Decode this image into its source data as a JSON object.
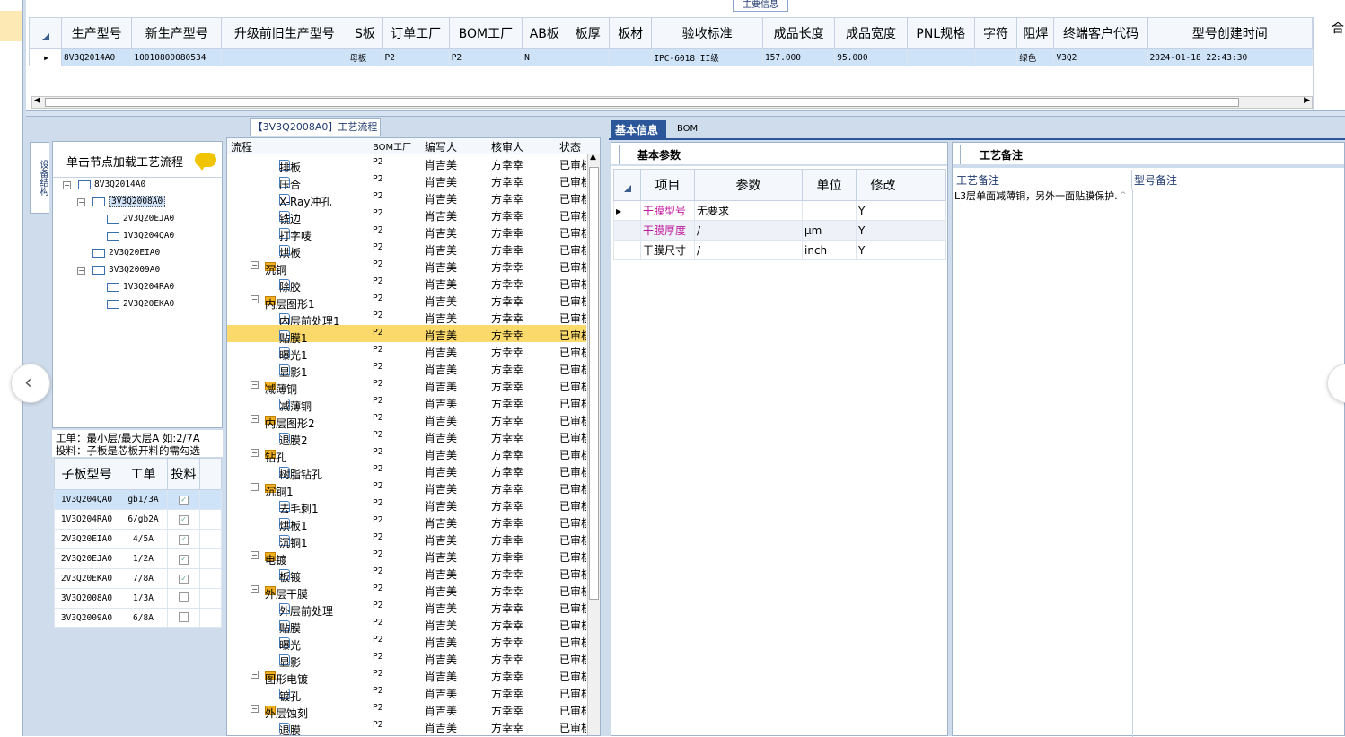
{
  "main_title": "主要信息",
  "top_table": {
    "headers": [
      "生产型号",
      "新生产型号",
      "升级前旧生产型号",
      "S板",
      "订单工厂",
      "BOM工厂",
      "AB板",
      "板厚",
      "板材",
      "验收标准",
      "成品长度",
      "成品宽度",
      "PNL规格",
      "字符",
      "阻焊",
      "终端客户代码",
      "型号创建时间"
    ],
    "extra_header": "合:",
    "row": [
      "8V3Q2014A0",
      "10010800080534",
      "",
      "母板",
      "P2",
      "P2",
      "N",
      "",
      "",
      "IPC-6018 II级",
      "157.000",
      "95.000",
      "",
      "",
      "绿色",
      "V3Q2",
      "2024-01-18 22:43:30"
    ]
  },
  "left": {
    "side_tab": "设备结构",
    "tree_header": "单击节点加载工艺流程",
    "tree": [
      "8V3Q2014A0",
      "3V3Q2008A0",
      "2V3Q20EJA0",
      "1V3Q204QA0",
      "2V3Q20EIA0",
      "3V3Q2009A0",
      "1V3Q204RA0",
      "2V3Q20EKA0"
    ],
    "note1": "工单：最小层/最大层A 如:2/7A",
    "note2": "投料：子板是芯板开料的需勾选",
    "sub_headers": [
      "子板型号",
      "工单",
      "投料"
    ],
    "sub_rows": [
      [
        "1V3Q204QA0",
        "gb1/3A"
      ],
      [
        "1V3Q204RA0",
        "6/gb2A"
      ],
      [
        "2V3Q20EIA0",
        "4/5A"
      ],
      [
        "2V3Q20EJA0",
        "1/2A"
      ],
      [
        "2V3Q20EKA0",
        "7/8A"
      ],
      [
        "3V3Q2008A0",
        "1/3A"
      ],
      [
        "3V3Q2009A0",
        "6/8A"
      ]
    ]
  },
  "flow": {
    "title": "【3V3Q2008A0】工艺流程",
    "headers": [
      "流程",
      "BOM工厂",
      "编写人",
      "核审人",
      "状态"
    ],
    "rows": [
      {
        "name": "排板",
        "f": "P2",
        "w": "肖吉美",
        "r": "方幸幸",
        "s": "已审核",
        "lvl": 2
      },
      {
        "name": "压合",
        "f": "P2",
        "w": "肖吉美",
        "r": "方幸幸",
        "s": "已审核",
        "lvl": 2
      },
      {
        "name": "X-Ray冲孔",
        "f": "P2",
        "w": "肖吉美",
        "r": "方幸幸",
        "s": "已审核",
        "lvl": 2
      },
      {
        "name": "铣边",
        "f": "P2",
        "w": "肖吉美",
        "r": "方幸幸",
        "s": "已审核",
        "lvl": 2
      },
      {
        "name": "打字唛",
        "f": "P2",
        "w": "肖吉美",
        "r": "方幸幸",
        "s": "已审核",
        "lvl": 2
      },
      {
        "name": "烘板",
        "f": "P2",
        "w": "肖吉美",
        "r": "方幸幸",
        "s": "已审核",
        "lvl": 2
      },
      {
        "name": "沉铜",
        "f": "P2",
        "w": "肖吉美",
        "r": "方幸幸",
        "s": "已审核",
        "lvl": 1
      },
      {
        "name": "除胶",
        "f": "P2",
        "w": "肖吉美",
        "r": "方幸幸",
        "s": "已审核",
        "lvl": 2
      },
      {
        "name": "内层图形1",
        "f": "P2",
        "w": "肖吉美",
        "r": "方幸幸",
        "s": "已审核",
        "lvl": 1
      },
      {
        "name": "内层前处理1",
        "f": "P2",
        "w": "肖吉美",
        "r": "方幸幸",
        "s": "已审核",
        "lvl": 2
      },
      {
        "name": "贴膜1",
        "f": "P2",
        "w": "肖吉美",
        "r": "方幸幸",
        "s": "已审核",
        "lvl": 2
      },
      {
        "name": "曝光1",
        "f": "P2",
        "w": "肖吉美",
        "r": "方幸幸",
        "s": "已审核",
        "lvl": 2
      },
      {
        "name": "显影1",
        "f": "P2",
        "w": "肖吉美",
        "r": "方幸幸",
        "s": "已审核",
        "lvl": 2
      },
      {
        "name": "减薄铜",
        "f": "P2",
        "w": "肖吉美",
        "r": "方幸幸",
        "s": "已审核",
        "lvl": 1
      },
      {
        "name": "减薄铜",
        "f": "P2",
        "w": "肖吉美",
        "r": "方幸幸",
        "s": "已审核",
        "lvl": 2
      },
      {
        "name": "内层图形2",
        "f": "P2",
        "w": "肖吉美",
        "r": "方幸幸",
        "s": "已审核",
        "lvl": 1
      },
      {
        "name": "退膜2",
        "f": "P2",
        "w": "肖吉美",
        "r": "方幸幸",
        "s": "已审核",
        "lvl": 2
      },
      {
        "name": "钻孔",
        "f": "P2",
        "w": "肖吉美",
        "r": "方幸幸",
        "s": "已审核",
        "lvl": 1
      },
      {
        "name": "树脂钻孔",
        "f": "P2",
        "w": "肖吉美",
        "r": "方幸幸",
        "s": "已审核",
        "lvl": 2
      },
      {
        "name": "沉铜1",
        "f": "P2",
        "w": "肖吉美",
        "r": "方幸幸",
        "s": "已审核",
        "lvl": 1
      },
      {
        "name": "去毛刺1",
        "f": "P2",
        "w": "肖吉美",
        "r": "方幸幸",
        "s": "已审核",
        "lvl": 2
      },
      {
        "name": "烘板1",
        "f": "P2",
        "w": "肖吉美",
        "r": "方幸幸",
        "s": "已审核",
        "lvl": 2
      },
      {
        "name": "沉铜1",
        "f": "P2",
        "w": "肖吉美",
        "r": "方幸幸",
        "s": "已审核",
        "lvl": 2
      },
      {
        "name": "电镀",
        "f": "P2",
        "w": "肖吉美",
        "r": "方幸幸",
        "s": "已审核",
        "lvl": 1
      },
      {
        "name": "板镀",
        "f": "P2",
        "w": "肖吉美",
        "r": "方幸幸",
        "s": "已审核",
        "lvl": 2
      },
      {
        "name": "外层干膜",
        "f": "P2",
        "w": "肖吉美",
        "r": "方幸幸",
        "s": "已审核",
        "lvl": 1
      },
      {
        "name": "外层前处理",
        "f": "P2",
        "w": "肖吉美",
        "r": "方幸幸",
        "s": "已审核",
        "lvl": 2
      },
      {
        "name": "贴膜",
        "f": "P2",
        "w": "肖吉美",
        "r": "方幸幸",
        "s": "已审核",
        "lvl": 2
      },
      {
        "name": "曝光",
        "f": "P2",
        "w": "肖吉美",
        "r": "方幸幸",
        "s": "已审核",
        "lvl": 2
      },
      {
        "name": "显影",
        "f": "P2",
        "w": "肖吉美",
        "r": "方幸幸",
        "s": "已审核",
        "lvl": 2
      },
      {
        "name": "图形电镀",
        "f": "P2",
        "w": "肖吉美",
        "r": "方幸幸",
        "s": "已审核",
        "lvl": 1
      },
      {
        "name": "镀孔",
        "f": "P2",
        "w": "肖吉美",
        "r": "方幸幸",
        "s": "已审核",
        "lvl": 2
      },
      {
        "name": "外层蚀刻",
        "f": "P2",
        "w": "肖吉美",
        "r": "方幸幸",
        "s": "已审核",
        "lvl": 1
      },
      {
        "name": "退膜",
        "f": "P2",
        "w": "肖吉美",
        "r": "方幸幸",
        "s": "已审核",
        "lvl": 2
      }
    ],
    "highlight_index": 10
  },
  "basic": {
    "tab_active": "基本信息",
    "tab_other": "BOM",
    "sub_tab": "基本参数",
    "headers": [
      "项目",
      "参数",
      "单位",
      "修改"
    ],
    "rows": [
      [
        "干膜型号",
        "无要求",
        "",
        "Y"
      ],
      [
        "干膜厚度",
        "/",
        "μm",
        "Y"
      ],
      [
        "干膜尺寸",
        "/",
        "inch",
        "Y"
      ]
    ]
  },
  "remark": {
    "tab": "工艺备注",
    "col1": "工艺备注",
    "col2": "型号备注",
    "text": "L3层单面减薄铜，另外一面贴膜保护."
  }
}
